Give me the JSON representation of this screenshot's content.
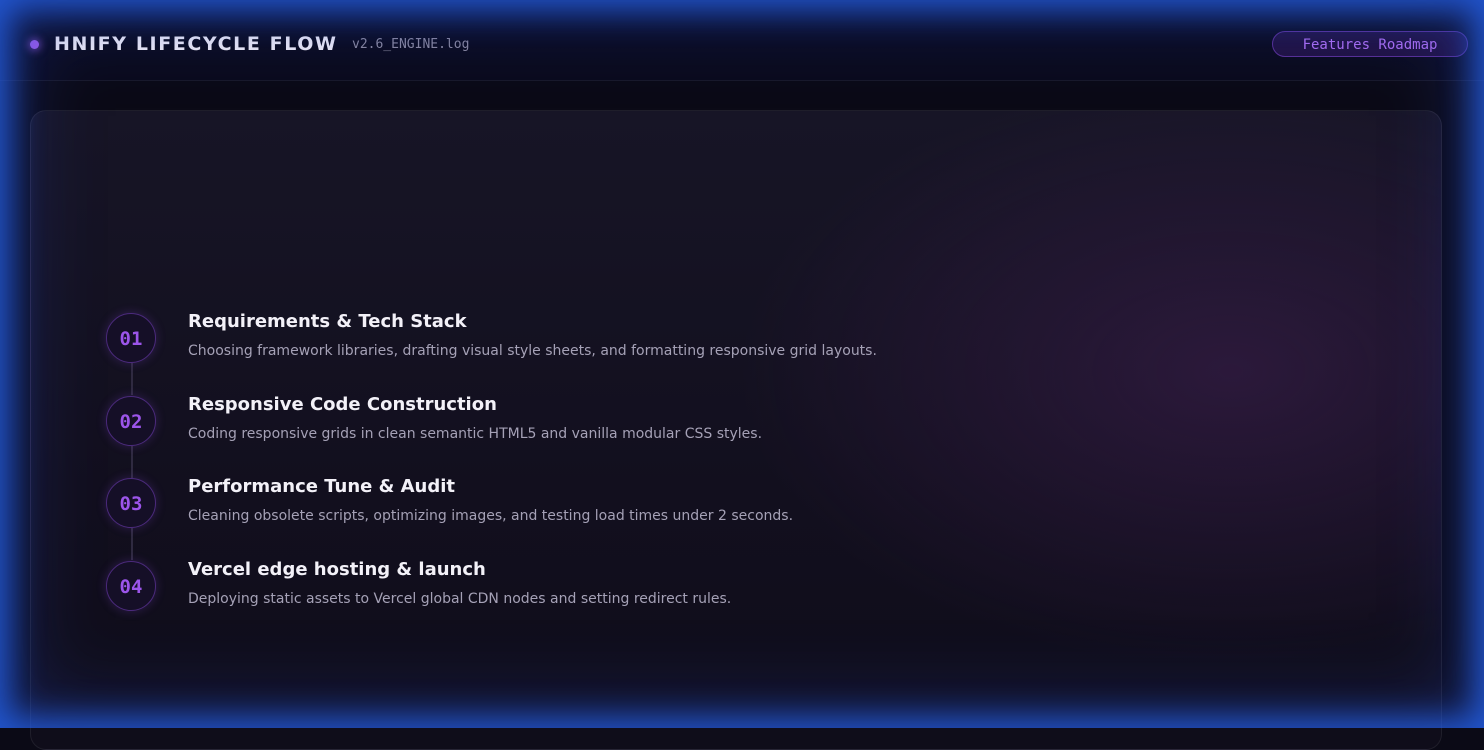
{
  "header": {
    "title": "HNIFY LIFECYCLE FLOW",
    "version": "v2.6_ENGINE.log",
    "roadmap_label": "Features Roadmap"
  },
  "steps": [
    {
      "number": "01",
      "title": "Requirements & Tech Stack",
      "description": "Choosing framework libraries, drafting visual style sheets, and formatting responsive grid layouts."
    },
    {
      "number": "02",
      "title": "Responsive Code Construction",
      "description": "Coding responsive grids in clean semantic HTML5 and vanilla modular CSS styles."
    },
    {
      "number": "03",
      "title": "Performance Tune & Audit",
      "description": "Cleaning obsolete scripts, optimizing images, and testing load times under 2 seconds."
    },
    {
      "number": "04",
      "title": "Vercel edge hosting & launch",
      "description": "Deploying static assets to Vercel global CDN nodes and setting redirect rules."
    }
  ],
  "colors": {
    "accent": "#9c55ea",
    "background": "#0b0a16",
    "frame_glow": "#2460e6"
  }
}
